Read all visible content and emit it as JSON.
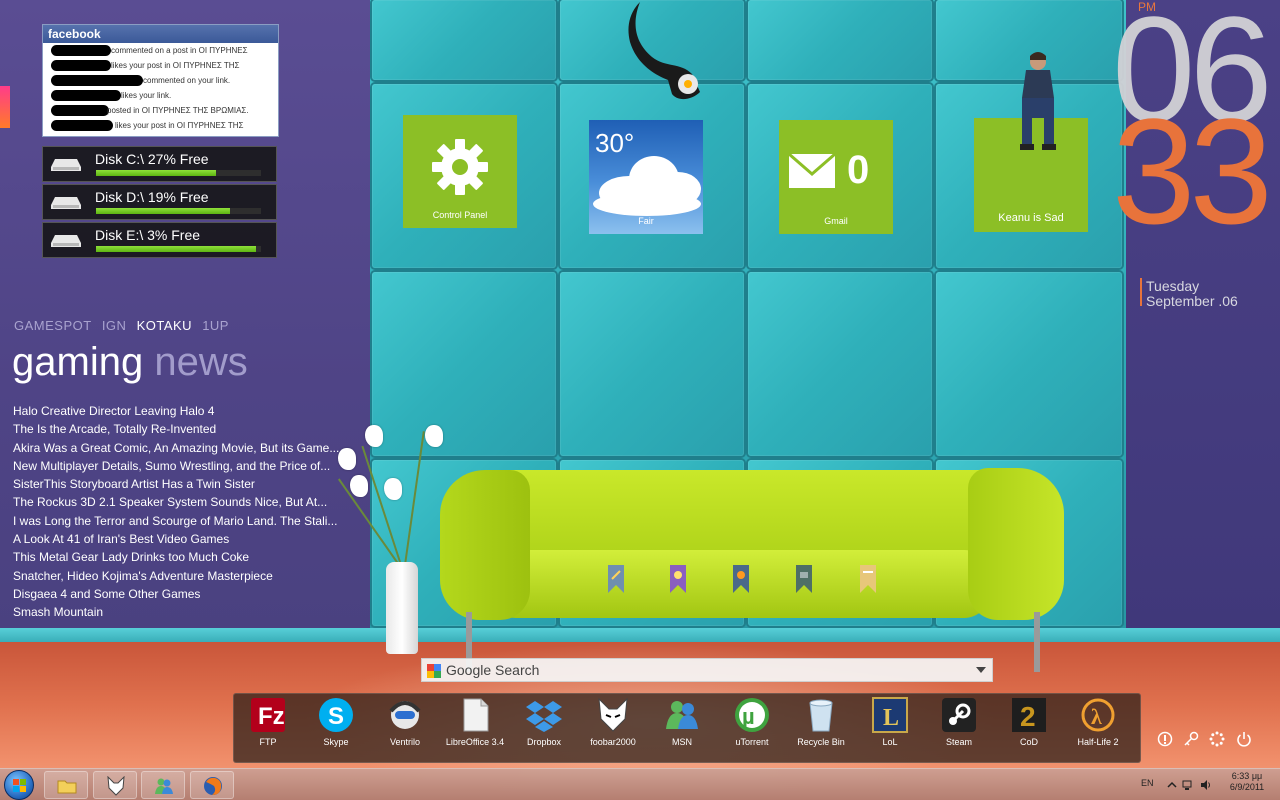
{
  "facebook": {
    "title": "facebook",
    "notifications": [
      "commented on a post in ΟΙ ΠΥΡΗΝΕΣ",
      "likes your post in ΟΙ ΠΥΡΗΝΕΣ ΤΗΣ",
      "commented on your link.",
      "likes your link.",
      "posted in ΟΙ ΠΥΡΗΝΕΣ ΤΗΣ ΒΡΩΜΙΑΣ.",
      "likes your post in ΟΙ ΠΥΡΗΝΕΣ ΤΗΣ"
    ]
  },
  "disks": [
    {
      "label": "Disk C:\\ 27% Free",
      "free": 0.73
    },
    {
      "label": "Disk D:\\ 19% Free",
      "free": 0.81
    },
    {
      "label": "Disk E:\\ 3% Free",
      "free": 0.97
    }
  ],
  "news": {
    "sources": [
      "GAMESPOT",
      "IGN",
      "KOTAKU",
      "1UP"
    ],
    "active_source": "KOTAKU",
    "title_main": "gaming",
    "title_dim": "news",
    "headlines": [
      "Halo Creative Director Leaving Halo 4",
      "The Is the Arcade, Totally Re-Invented",
      "Akira Was a Great Comic, An Amazing Movie, But its Game...",
      "New Multiplayer Details, Sumo Wrestling, and the Price of...",
      "SisterThis Storyboard Artist Has a Twin Sister",
      "The Rockus 3D 2.1 Speaker System Sounds Nice, But At...",
      "I was Long the Terror and Scourge of Mario Land. The Stali...",
      "A Look At 41 of Iran's Best Video Games",
      "This Metal Gear Lady Drinks too Much Coke",
      "Snatcher, Hideo Kojima's Adventure Masterpiece",
      "Disgaea 4 and Some Other Games",
      "Smash Mountain"
    ]
  },
  "tiles": {
    "control_panel": "Control Panel",
    "weather_temp": "30°",
    "weather_label": "Fair",
    "gmail_count": "0",
    "gmail_label": "Gmail",
    "keanu_label": "Keanu is Sad"
  },
  "clock": {
    "ampm": "PM",
    "hour": "06",
    "minute": "33",
    "day": "Tuesday",
    "date": "September .06"
  },
  "search": {
    "label": "Google Search"
  },
  "dock": [
    {
      "label": "FTP",
      "icon": "filezilla-icon",
      "color": "#b3001b"
    },
    {
      "label": "Skype",
      "icon": "skype-icon",
      "color": "#00aff0"
    },
    {
      "label": "Ventrilo",
      "icon": "ventrilo-icon",
      "color": "#e8e8e8"
    },
    {
      "label": "LibreOffice 3.4",
      "icon": "libreoffice-icon",
      "color": "#f2f2f2"
    },
    {
      "label": "Dropbox",
      "icon": "dropbox-icon",
      "color": "#3d9ae8"
    },
    {
      "label": "foobar2000",
      "icon": "foobar-icon",
      "color": "#ffffff"
    },
    {
      "label": "MSN",
      "icon": "msn-icon",
      "color": "#5cb85c"
    },
    {
      "label": "uTorrent",
      "icon": "utorrent-icon",
      "color": "#3fa33f"
    },
    {
      "label": "Recycle Bin",
      "icon": "recycle-bin-icon",
      "color": "#cfe2f0"
    },
    {
      "label": "LoL",
      "icon": "league-of-legends-icon",
      "color": "#1c3a73"
    },
    {
      "label": "Steam",
      "icon": "steam-icon",
      "color": "#222222"
    },
    {
      "label": "CoD",
      "icon": "call-of-duty-icon",
      "color": "#c8961e"
    },
    {
      "label": "Half-Life 2",
      "icon": "half-life-icon",
      "color": "#f0a030"
    }
  ],
  "tray": {
    "lang": "EN",
    "time": "6:33 μμ",
    "date": "6/9/2011"
  },
  "colors": {
    "accent_orange": "#e8733b",
    "tile_green": "#8cbf26",
    "facebook_blue": "#3b5998"
  }
}
